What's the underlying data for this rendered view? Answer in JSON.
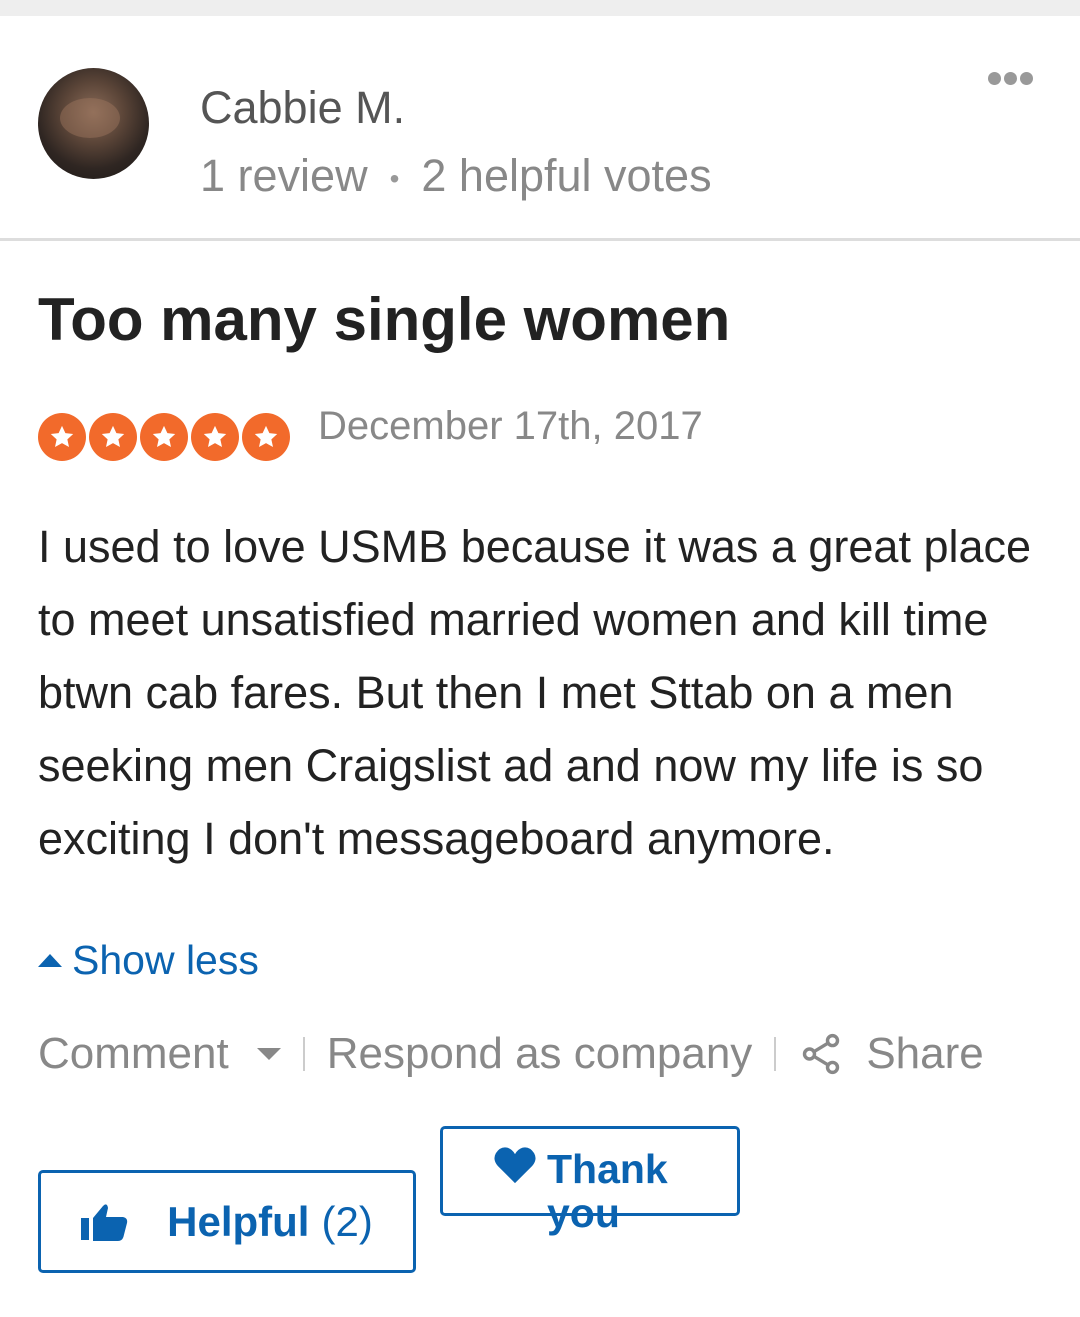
{
  "review": {
    "author": {
      "name": "Cabbie M.",
      "review_count": "1 review",
      "helpful_votes": "2 helpful votes"
    },
    "title": "Too many single women",
    "rating": 5,
    "date": "December 17th, 2017",
    "body": "I used to love USMB because it was a great place to meet unsatisfied married women and kill time btwn cab fares. But then I met Sttab on a men seeking men Craigslist ad and now my life is so exciting I don't messageboard anymore.",
    "show_less_label": "Show less"
  },
  "actions": {
    "comment_label": "Comment",
    "respond_label": "Respond as company",
    "share_label": "Share"
  },
  "buttons": {
    "helpful_label": "Helpful",
    "helpful_count": "(2)",
    "thank_label": "Thank you"
  },
  "colors": {
    "star": "#f26a2b",
    "link": "#0b63b0"
  },
  "icons": {
    "more": "more-horizontal-icon",
    "share": "share-icon",
    "helpful": "thumbs-up-icon",
    "thank": "heart-icon",
    "star": "star-icon"
  }
}
